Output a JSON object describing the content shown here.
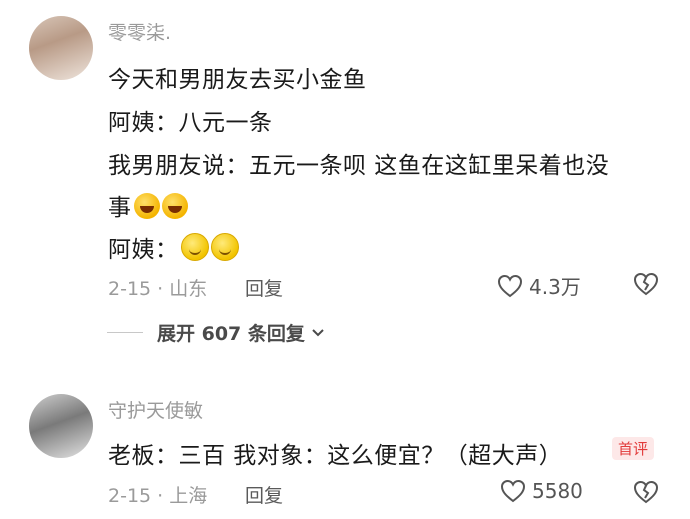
{
  "comments": [
    {
      "username": "零零柒.",
      "lines": [
        "今天和男朋友去买小金鱼",
        "阿姨：八元一条",
        "我男朋友说：五元一条呗 这鱼在这缸里呆着也没",
        "事",
        "阿姨："
      ],
      "date_location": "2-15 · 山东",
      "reply_label": "回复",
      "likes": "4.3万",
      "expand_label": "展开 607 条回复"
    },
    {
      "username": "守护天使敏",
      "lines": [
        "老板：三百 我对象：这么便宜？（超大声）"
      ],
      "badge": "首评",
      "date_location": "2-15 · 上海",
      "reply_label": "回复",
      "likes": "5580"
    }
  ],
  "icons": {
    "like": "heart-outline-icon",
    "dislike": "broken-heart-icon",
    "expand": "chevron-down-icon"
  },
  "colors": {
    "text": "#1a1a1a",
    "meta": "#9a9a9a",
    "badge": "#e23b3b"
  }
}
